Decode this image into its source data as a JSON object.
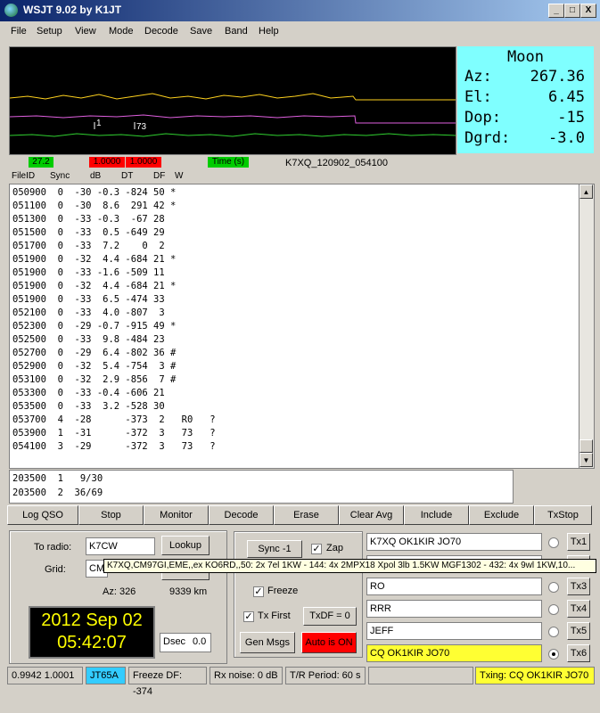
{
  "window": {
    "title": "WSJT 9.02    by K1JT",
    "min": "_",
    "max": "□",
    "close": "X"
  },
  "menu": [
    "File",
    "Setup",
    "View",
    "Mode",
    "Decode",
    "Save",
    "Band",
    "Help"
  ],
  "graph": {
    "label_1": "1",
    "label_73": "73"
  },
  "moon": {
    "title": "Moon",
    "az_label": "Az:",
    "az": "267.36",
    "el_label": "El:",
    "el": "6.45",
    "dop_label": "Dop:",
    "dop": "-15",
    "dgrd_label": "Dgrd:",
    "dgrd": "-3.0"
  },
  "status_boxes": {
    "level": "27.2",
    "v1": "1.0000",
    "v2": "1.0000",
    "time": "Time (s)",
    "file": "K7XQ_120902_054100"
  },
  "columns": {
    "fileid": "FileID",
    "sync": "Sync",
    "db": "dB",
    "dt": "DT",
    "df": "DF",
    "w": "W"
  },
  "decoded_lines": [
    "050900  0  -30 -0.3 -824 50 *",
    "051100  0  -30  8.6  291 42 *",
    "051300  0  -33 -0.3  -67 28",
    "051500  0  -33  0.5 -649 29",
    "051700  0  -33  7.2    0  2",
    "051900  0  -32  4.4 -684 21 *",
    "051900  0  -33 -1.6 -509 11",
    "051900  0  -32  4.4 -684 21 *",
    "051900  0  -33  6.5 -474 33",
    "052100  0  -33  4.0 -807  3",
    "052300  0  -29 -0.7 -915 49 *",
    "052500  0  -33  9.8 -484 23",
    "052700  0  -29  6.4 -802 36 #",
    "052900  0  -32  5.4 -754  3 #",
    "053100  0  -32  2.9 -856  7 #",
    "053300  0  -33 -0.4 -606 21",
    "053500  0  -33  3.2 -528 30",
    "053700  4  -28      -373  2   R0   ?",
    "053900  1  -31      -372  3   73   ?",
    "054100  3  -29      -372  3   73   ?"
  ],
  "avg_lines": [
    "203500  1   9/30",
    "203500  2  36/69"
  ],
  "buttons": [
    "Log QSO",
    "Stop",
    "Monitor",
    "Decode",
    "Erase",
    "Clear Avg",
    "Include",
    "Exclude",
    "TxStop"
  ],
  "left_panel": {
    "to_radio_label": "To radio:",
    "to_radio": "K7CW",
    "lookup": "Lookup",
    "grid_label": "Grid:",
    "grid": "CM",
    "az": "Az: 326",
    "km": "9339 km",
    "date": "2012 Sep 02",
    "time": "05:42:07",
    "dsec_label": "Dsec",
    "dsec": "0.0"
  },
  "tooltip": "K7XQ,CM97GI,EME,,ex KO6RD,,50: 2x 7el 1KW - 144: 4x 2MPX18 Xpol 3lb 1.5KW  MGF1302 - 432: 4x 9wl  1KW,10...",
  "mid_panel": {
    "sync": "Sync  -1",
    "zap": "Zap",
    "freeze": "Freeze",
    "tx_first": "Tx First",
    "txdf": "TxDF = 0",
    "gen_msgs": "Gen Msgs",
    "auto": "Auto is  ON"
  },
  "tx": [
    {
      "msg": "K7XQ OK1KIR JO70",
      "btn": "Tx1"
    },
    {
      "msg": "",
      "btn": "Tx2"
    },
    {
      "msg": "RO",
      "btn": "Tx3"
    },
    {
      "msg": "RRR",
      "btn": "Tx4"
    },
    {
      "msg": "JEFF",
      "btn": "Tx5"
    },
    {
      "msg": "CQ OK1KIR JO70",
      "btn": "Tx6"
    }
  ],
  "statusbar": {
    "ratio": "0.9942 1.0001",
    "mode": "JT65A",
    "freeze": "Freeze DF: -374",
    "rxnoise": "Rx noise:  0 dB",
    "period": "T/R Period: 60 s",
    "txing": "Txing:  CQ OK1KIR JO70"
  },
  "colors": {
    "moon_bg": "#7fffff",
    "red": "#ff0000",
    "green": "#00cc00",
    "yellow": "#ffff33",
    "clock_bg": "#000000",
    "clock_fg": "#ffff00"
  }
}
